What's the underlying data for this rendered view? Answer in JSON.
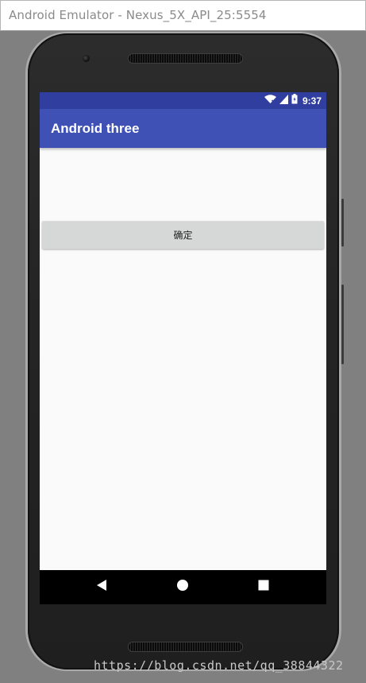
{
  "window": {
    "title": "Android Emulator - Nexus_5X_API_25:5554"
  },
  "status_bar": {
    "time": "9:37",
    "icons": [
      "wifi-icon",
      "signal-icon",
      "battery-icon"
    ]
  },
  "app_bar": {
    "title": "Android three"
  },
  "main": {
    "confirm_button_label": "确定"
  },
  "nav_bar": {
    "icons": [
      "back-icon",
      "home-icon",
      "recents-icon"
    ]
  },
  "watermark": {
    "text": "https://blog.csdn.net/qq_38844322"
  },
  "colors": {
    "status_bar": "#303f9f",
    "app_bar": "#3f51b5",
    "button": "#d6d7d7",
    "screen_background": "#fafafa"
  }
}
